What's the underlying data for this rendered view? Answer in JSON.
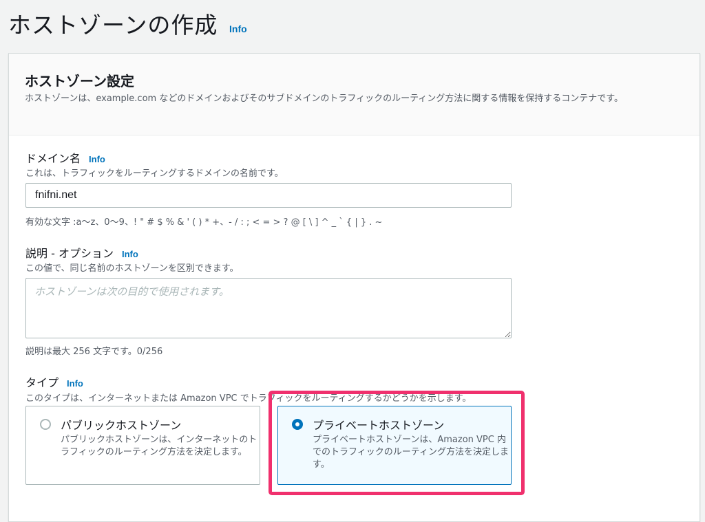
{
  "header": {
    "title": "ホストゾーンの作成",
    "info": "Info"
  },
  "settings": {
    "title": "ホストゾーン設定",
    "description": "ホストゾーンは、example.com などのドメインおよびそのサブドメインのトラフィックのルーティング方法に関する情報を保持するコンテナです。"
  },
  "domain": {
    "label": "ドメイン名",
    "info": "Info",
    "description": "これは、トラフィックをルーティングするドメインの名前です。",
    "value": "fnifni.net",
    "constraint": "有効な文字 :a〜z、0〜9、! \" # $ % & ' ( ) * +、- / : ; < = > ? @ [ \\ ] ^ _ ` { | } . ~"
  },
  "description_field": {
    "label": "説明 - オプション",
    "info": "Info",
    "description": "この値で、同じ名前のホストゾーンを区別できます。",
    "placeholder": "ホストゾーンは次の目的で使用されます。",
    "constraint": "説明は最大 256 文字です。0/256"
  },
  "type": {
    "label": "タイプ",
    "info": "Info",
    "description": "このタイプは、インターネットまたは Amazon VPC でトラフィックをルーティングするかどうかを示します。",
    "options": [
      {
        "title": "パブリックホストゾーン",
        "description": "パブリックホストゾーンは、インターネットのトラフィックのルーティング方法を決定します。",
        "selected": false
      },
      {
        "title": "プライベートホストゾーン",
        "description": "プライベートホストゾーンは、Amazon VPC 内でのトラフィックのルーティング方法を決定します。",
        "selected": true
      }
    ]
  },
  "colors": {
    "accent": "#0073bb",
    "highlight": "#f0306d"
  }
}
